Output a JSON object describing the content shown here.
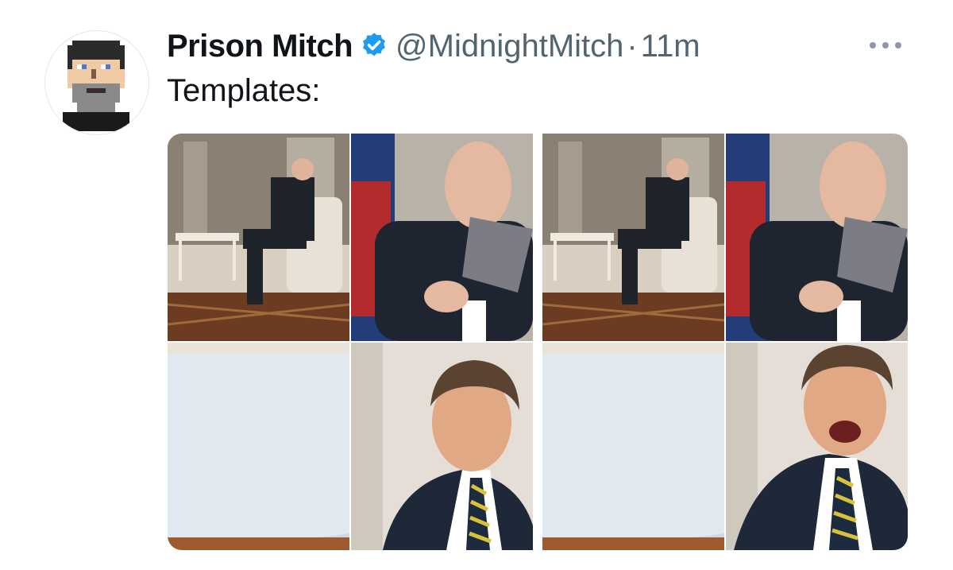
{
  "tweet": {
    "author_name": "Prison Mitch",
    "handle": "@MidnightMitch",
    "separator": "·",
    "time": "11m",
    "text": "Templates:",
    "verified_icon": "verified-badge-icon",
    "more_icon": "more-options-icon"
  },
  "colors": {
    "name": "#0f1419",
    "meta": "#536471",
    "verified": "#1d9bf0"
  }
}
